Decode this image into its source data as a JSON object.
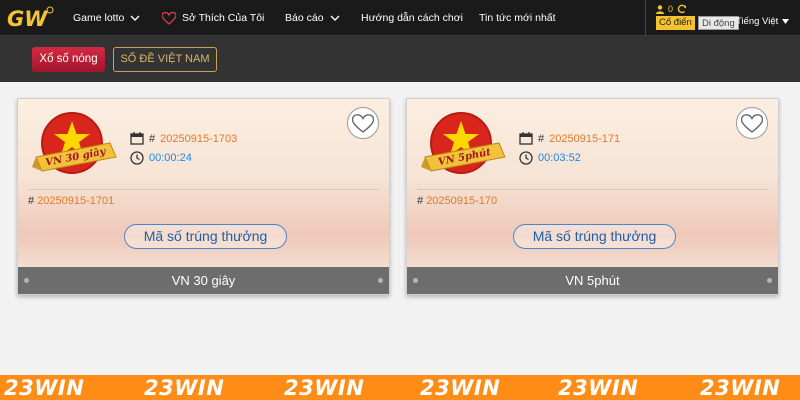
{
  "nav": {
    "items": [
      {
        "label": "Game lotto",
        "has_chevron": true
      },
      {
        "label": "Sở Thích Của Tôi",
        "icon": "heart-icon"
      },
      {
        "label": "Báo cáo",
        "has_chevron": true
      },
      {
        "label": "Hướng dẫn cách chơi"
      },
      {
        "label": "Tin tức mới nhất"
      }
    ],
    "balance": "0",
    "mode_classic": "Cổ điển",
    "mode_mobile": "Di động",
    "language": "Tiếng Việt"
  },
  "category_tabs": {
    "hot": "Xổ số nóng",
    "vn": "SỐ ĐỀ VIỆT NAM"
  },
  "cards": [
    {
      "badge_text": "VN 30 giây",
      "current_issue": "20250915-1703",
      "countdown": "00:00:24",
      "previous_issue": "20250915-1701",
      "hash": "#",
      "winning_button": "Mã số trúng thưởng",
      "footer": "VN 30 giây"
    },
    {
      "badge_text": "VN 5phút",
      "current_issue": "20250915-171",
      "countdown": "00:03:52",
      "previous_issue": "20250915-170",
      "hash": "#",
      "winning_button": "Mã số trúng thưởng",
      "footer": "VN 5phút"
    }
  ],
  "watermark": [
    "23WIN",
    "23WIN",
    "23WIN",
    "23WIN",
    "23WIN",
    "23WIN"
  ],
  "colors": {
    "accent_gold": "#f4c430",
    "hot_tab": "#c41f38",
    "issue_orange": "#e07a2e",
    "timer_blue": "#1e88e5",
    "strip_orange": "#ff8c16"
  }
}
